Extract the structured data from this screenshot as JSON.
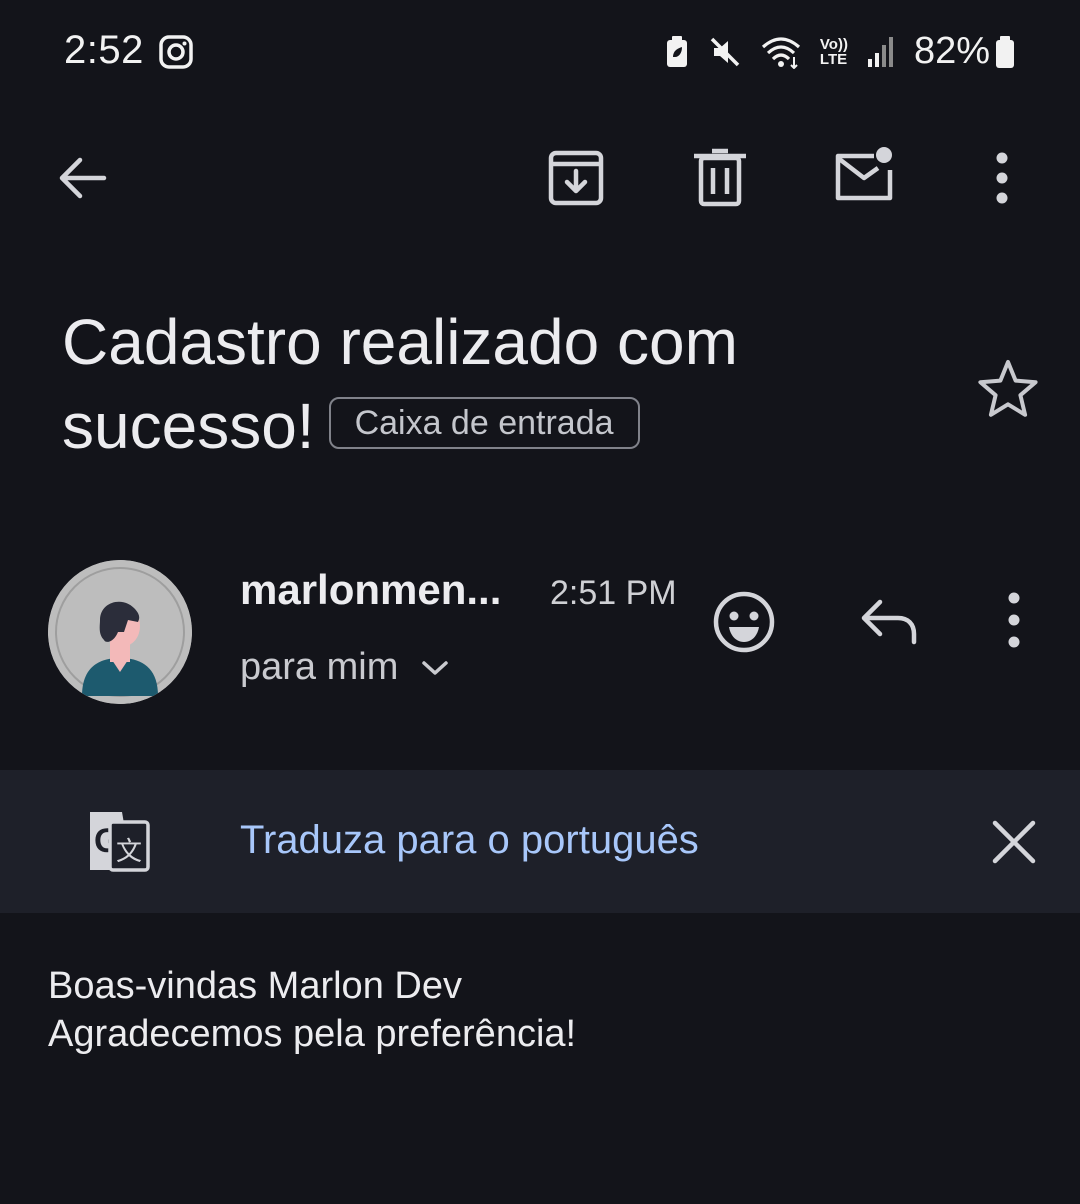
{
  "status_bar": {
    "time": "2:52",
    "battery_percent": "82%",
    "icons": [
      "instagram-icon",
      "battery-saver-icon",
      "mute-icon",
      "wifi-icon",
      "volte-icon",
      "signal-icon",
      "battery-icon"
    ],
    "volte_line1": "Vo))",
    "volte_line2": "LTE"
  },
  "toolbar": {
    "icons": [
      "back-arrow-icon",
      "archive-icon",
      "delete-icon",
      "mark-unread-icon",
      "more-vert-icon"
    ]
  },
  "email": {
    "subject_line1": "Cadastro realizado com",
    "subject_line2": "sucesso!",
    "label": "Caixa de entrada",
    "sender": "marlonmen...",
    "time": "2:51 PM",
    "recipient": "para mim",
    "body_line1": "Boas-vindas Marlon Dev",
    "body_line2": "Agradecemos pela preferência!"
  },
  "translate": {
    "text": "Traduza para o português"
  },
  "colors": {
    "background": "#13141a",
    "translate_bar": "#1e2029",
    "translate_link": "#a8c7fa",
    "avatar_bg": "#bdbdbd",
    "avatar_shirt": "#1d5a6e"
  }
}
